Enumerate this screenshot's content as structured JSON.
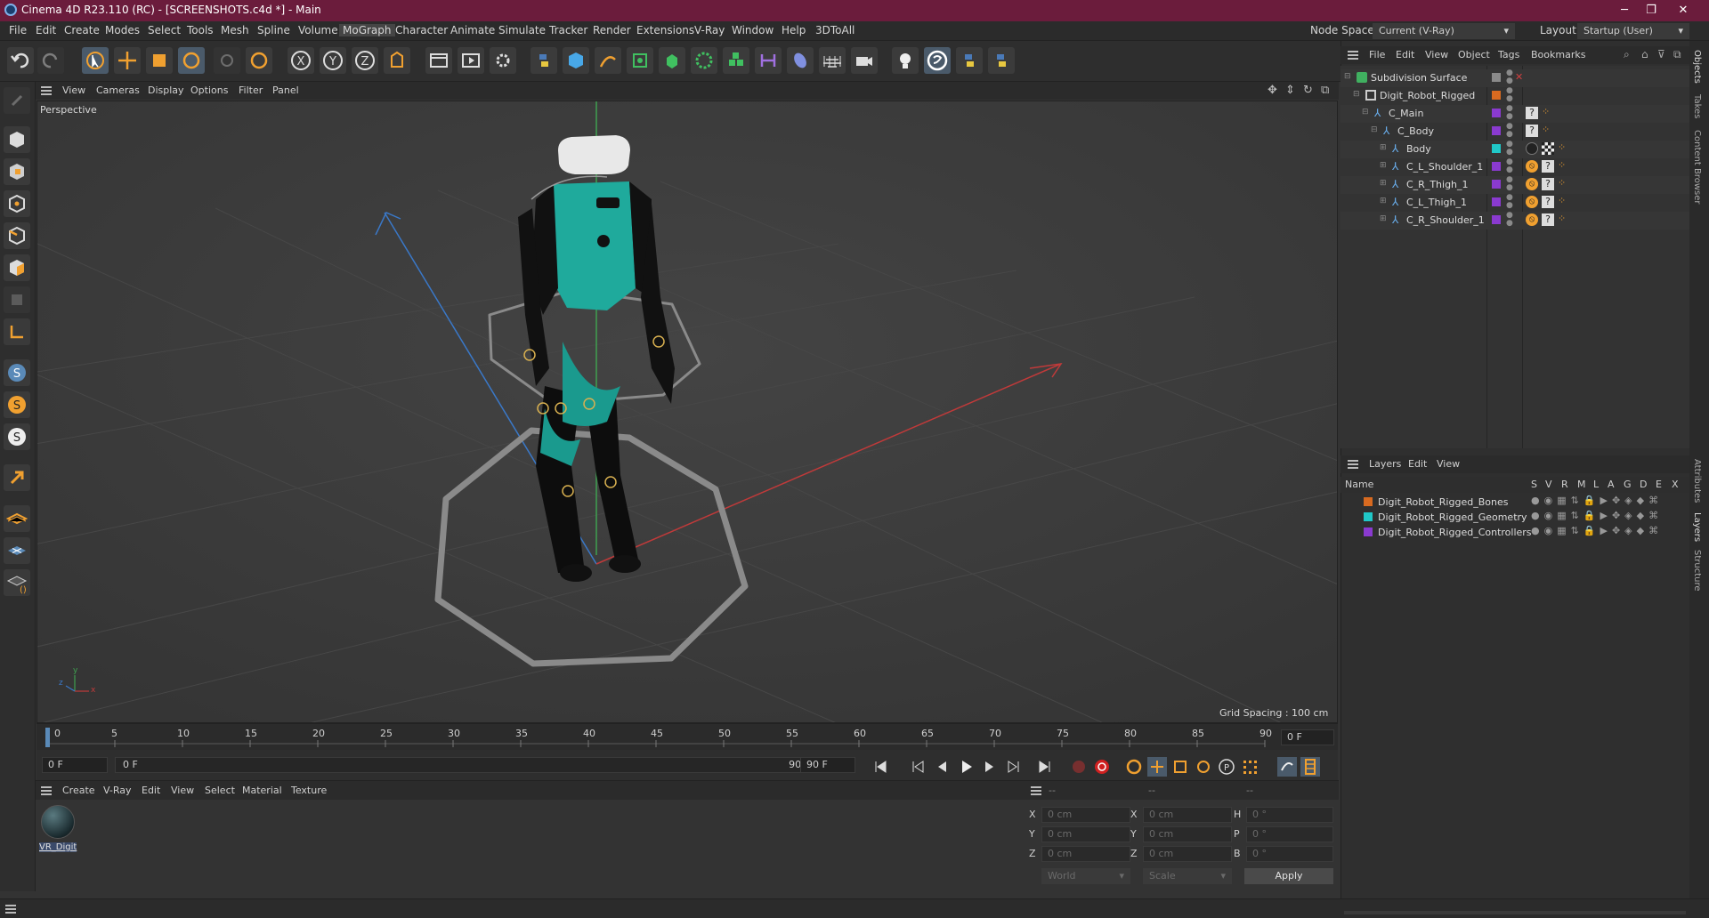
{
  "window": {
    "title": "Cinema 4D R23.110 (RC) - [SCREENSHOTS.c4d *] - Main",
    "controls": [
      "─",
      "❐",
      "✕"
    ]
  },
  "menubar": {
    "items": [
      "File",
      "Edit",
      "Create",
      "Modes",
      "Select",
      "Tools",
      "Mesh",
      "Spline",
      "Volume",
      "MoGraph",
      "Character",
      "Animate",
      "Simulate",
      "Tracker",
      "Render",
      "Extensions",
      "V-Ray",
      "Window",
      "Help",
      "3DToAll"
    ],
    "active": "MoGraph",
    "node_space_label": "Node Space:",
    "node_space_value": "Current (V-Ray)",
    "layout_label": "Layout:",
    "layout_value": "Startup (User)"
  },
  "viewport": {
    "menu": [
      "View",
      "Cameras",
      "Display",
      "Options",
      "Filter",
      "Panel"
    ],
    "label": "Perspective",
    "grid_spacing": "Grid Spacing : 100 cm",
    "axis_y": "y",
    "axis_x": "x",
    "axis_z": "z"
  },
  "timeline": {
    "ticks": [
      "0",
      "5",
      "10",
      "15",
      "20",
      "25",
      "30",
      "35",
      "40",
      "45",
      "50",
      "55",
      "60",
      "65",
      "70",
      "75",
      "80",
      "85",
      "90"
    ],
    "current_frame_right": "0 F"
  },
  "transport": {
    "start_field": "0 F",
    "range_start": "0 F",
    "range_end": "90 F",
    "end_field": "90 F"
  },
  "material_manager": {
    "menu": [
      "Create",
      "V-Ray",
      "Edit",
      "View",
      "Select",
      "Material",
      "Texture"
    ],
    "materials": [
      {
        "name": "VR_Digit"
      }
    ]
  },
  "coordinates": {
    "header_left": "--",
    "header_mid": "--",
    "header_right": "--",
    "rows": [
      {
        "a": "X",
        "av": "0 cm",
        "b": "X",
        "bv": "0 cm",
        "c": "H",
        "cv": "0 °"
      },
      {
        "a": "Y",
        "av": "0 cm",
        "b": "Y",
        "bv": "0 cm",
        "c": "P",
        "cv": "0 °"
      },
      {
        "a": "Z",
        "av": "0 cm",
        "b": "Z",
        "bv": "0 cm",
        "c": "B",
        "cv": "0 °"
      }
    ],
    "mode": "World",
    "scale": "Scale",
    "apply": "Apply"
  },
  "object_manager": {
    "menu": [
      "File",
      "Edit",
      "View",
      "Object",
      "Tags",
      "Bookmarks"
    ],
    "objects": [
      {
        "name": "Subdivision Surface",
        "color": "#c8a060"
      },
      {
        "name": "Digit_Robot_Rigged",
        "color": "#d86a20"
      },
      {
        "name": "C_Main",
        "color": "#8a3ad0"
      },
      {
        "name": "C_Body",
        "color": "#8a3ad0"
      },
      {
        "name": "Body",
        "color": "#20c8c8"
      },
      {
        "name": "C_L_Shoulder_1",
        "color": "#8a3ad0"
      },
      {
        "name": "C_R_Thigh_1",
        "color": "#8a3ad0"
      },
      {
        "name": "C_L_Thigh_1",
        "color": "#8a3ad0"
      },
      {
        "name": "C_R_Shoulder_1",
        "color": "#8a3ad0"
      }
    ]
  },
  "layers": {
    "menu": [
      "Layers",
      "Edit",
      "View"
    ],
    "columns": [
      "Name",
      "S",
      "V",
      "R",
      "M",
      "L",
      "A",
      "G",
      "D",
      "E",
      "X"
    ],
    "items": [
      {
        "name": "Digit_Robot_Rigged_Bones",
        "color": "#d86a20"
      },
      {
        "name": "Digit_Robot_Rigged_Geometry",
        "color": "#20c8c8"
      },
      {
        "name": "Digit_Robot_Rigged_Controllers",
        "color": "#8a3ad0"
      }
    ]
  },
  "side_tabs": [
    "Objects",
    "Takes",
    "Content Browser",
    "Attributes",
    "Layers",
    "Structure"
  ]
}
